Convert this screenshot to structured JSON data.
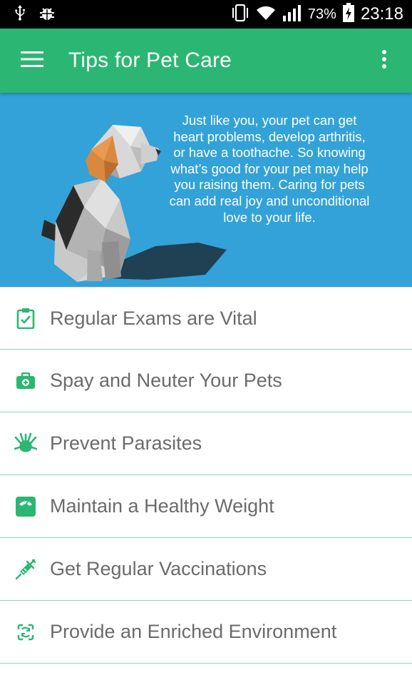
{
  "status_bar": {
    "battery_percent": "73%",
    "time": "23:18",
    "icons": [
      "usb-icon",
      "bug-icon",
      "vibrate-icon",
      "wifi-icon",
      "signal-icon",
      "battery-charging-icon"
    ]
  },
  "app_bar": {
    "title": "Tips for Pet Care",
    "menu_icon": "hamburger-menu-icon",
    "overflow_icon": "more-vert-icon",
    "color": "#2bb673"
  },
  "hero": {
    "text": "Just like you, your pet can get heart problems, develop arthritis, or have a toothache. So knowing what’s good for your pet may help you raising them. Caring for pets can add real joy and unconditional love to your life.",
    "background": "#33a2d8"
  },
  "tips": [
    {
      "label": "Regular Exams are Vital",
      "icon": "clipboard-check-icon"
    },
    {
      "label": "Spay and Neuter Your Pets",
      "icon": "first-aid-kit-icon"
    },
    {
      "label": "Prevent Parasites",
      "icon": "parasite-icon"
    },
    {
      "label": "Maintain a Healthy Weight",
      "icon": "weight-scale-icon"
    },
    {
      "label": "Get Regular Vaccinations",
      "icon": "syringe-icon"
    },
    {
      "label": "Provide an Enriched Environment",
      "icon": "refresh-frame-icon"
    }
  ],
  "colors": {
    "accent": "#2bb673",
    "divider": "#8fd3b6",
    "text": "#6b6b6b"
  }
}
